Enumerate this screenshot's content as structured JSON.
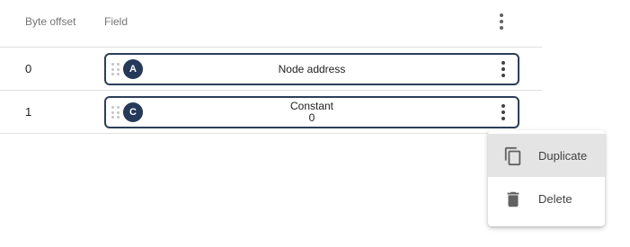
{
  "table": {
    "headers": {
      "byte_offset": "Byte offset",
      "field": "Field"
    },
    "rows": [
      {
        "offset": "0",
        "badge": "A",
        "label": "Node address",
        "sublabel": ""
      },
      {
        "offset": "1",
        "badge": "C",
        "label": "Constant",
        "sublabel": "0"
      }
    ]
  },
  "context_menu": {
    "items": [
      {
        "label": "Duplicate",
        "icon": "copy-icon"
      },
      {
        "label": "Delete",
        "icon": "trash-icon"
      }
    ]
  },
  "colors": {
    "badge": "#25395a",
    "chip_border": "#2c3e5a",
    "menu_highlight": "#e4e4e4"
  }
}
